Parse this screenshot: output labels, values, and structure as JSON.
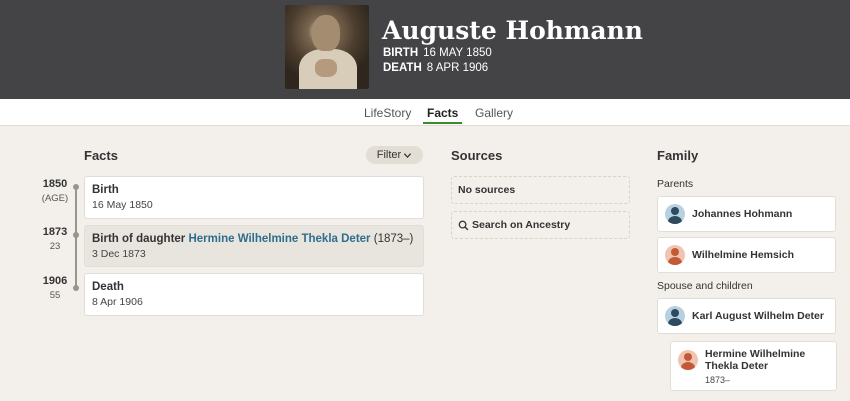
{
  "profile": {
    "name": "Auguste Hohmann",
    "birth_label": "BIRTH",
    "birth_date": "16 MAY 1850",
    "death_label": "DEATH",
    "death_date": "8 APR 1906"
  },
  "tabs": [
    {
      "label": "LifeStory",
      "active": false
    },
    {
      "label": "Facts",
      "active": true
    },
    {
      "label": "Gallery",
      "active": false
    }
  ],
  "facts": {
    "title": "Facts",
    "filter_label": "Filter",
    "timeline": [
      {
        "year": "1850",
        "age": "(AGE)"
      },
      {
        "year": "1873",
        "age": "23"
      },
      {
        "year": "1906",
        "age": "55"
      }
    ],
    "items": [
      {
        "title": "Birth",
        "date": "16 May 1850"
      },
      {
        "title": "Birth of daughter",
        "link": "Hermine Wilhelmine Thekla Deter",
        "extra": "(1873–)",
        "date": "3 Dec 1873"
      },
      {
        "title": "Death",
        "date": "8 Apr 1906"
      }
    ]
  },
  "sources": {
    "title": "Sources",
    "no_sources": "No sources",
    "search_label": "Search on Ancestry"
  },
  "family": {
    "title": "Family",
    "parents_label": "Parents",
    "parents": [
      {
        "name": "Johannes Hohmann",
        "gender": "male"
      },
      {
        "name": "Wilhelmine Hemsich",
        "gender": "female"
      }
    ],
    "spouse_label": "Spouse and children",
    "spouse": {
      "name": "Karl August Wilhelm Deter",
      "gender": "male"
    },
    "children": [
      {
        "name_line1": "Hermine Wilhelmine",
        "name_line2": "Thekla Deter",
        "life": "1873–",
        "gender": "female"
      }
    ]
  },
  "colors": {
    "header_bg": "#444446",
    "accent_tab": "#3b8b2c",
    "link": "#2f6d8e",
    "page_bg": "#f3f0eb"
  }
}
